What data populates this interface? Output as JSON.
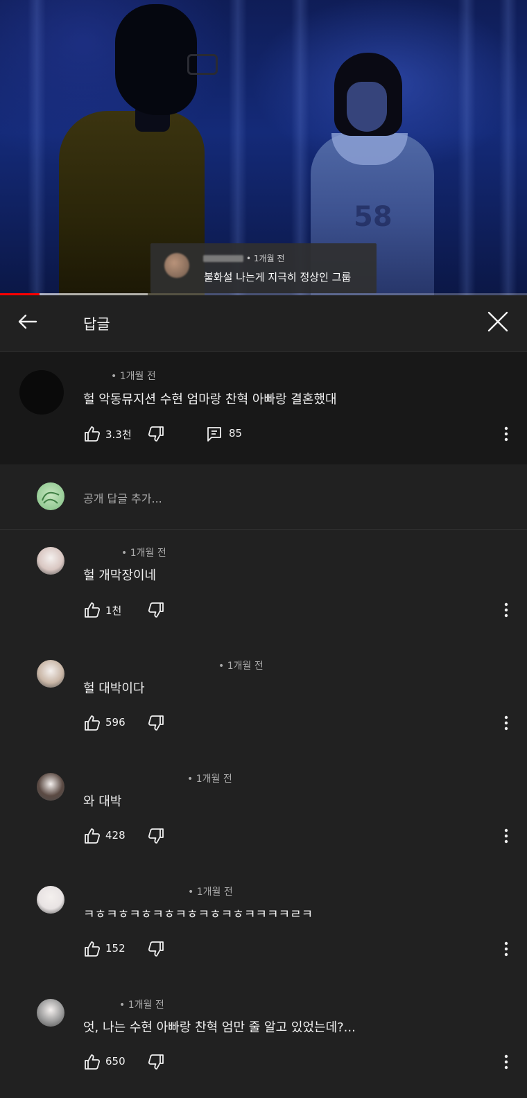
{
  "video": {
    "pinned_comment": {
      "meta": "• 1개월 전",
      "text": "불화설 나는게 지극히 정상인 그룹"
    },
    "number_on_shirt": "58",
    "progress": {
      "played_fraction": 0.075,
      "buffered_fraction": 0.28
    }
  },
  "header": {
    "title": "답글",
    "back_icon": "arrow-left-icon",
    "close_icon": "close-icon"
  },
  "parent_comment": {
    "meta": "• 1개월 전",
    "text": "헐 악동뮤지션 수현 엄마랑 찬혁 아빠랑 결혼했대",
    "likes": "3.3천",
    "replies": "85"
  },
  "add_reply": {
    "placeholder": "공개 답글 추가..."
  },
  "replies": [
    {
      "meta": "• 1개월 전",
      "text": "헐 개막장이네",
      "likes": "1천",
      "avatar_color": "#d9c7c2"
    },
    {
      "meta": "• 1개월 전",
      "text": "헐 대박이다",
      "likes": "596",
      "avatar_color": "#c9b6a6"
    },
    {
      "meta": "• 1개월 전",
      "text": "와 대박",
      "likes": "428",
      "avatar_color": "#5b4a43"
    },
    {
      "meta": "• 1개월 전",
      "text": "ㅋㅎㅋㅎㅋㅎㅋㅎㅋㅎㅋㅎㅋㅎㅋㅋㅋㅋㄹㅋ",
      "likes": "152",
      "avatar_color": "#e8e3e3"
    },
    {
      "meta": "• 1개월 전",
      "text": "엇, 나는 수현 아빠랑 찬혁 엄만 줄 알고 있었는데?...",
      "likes": "650",
      "avatar_color": "#9a9a9a"
    }
  ]
}
